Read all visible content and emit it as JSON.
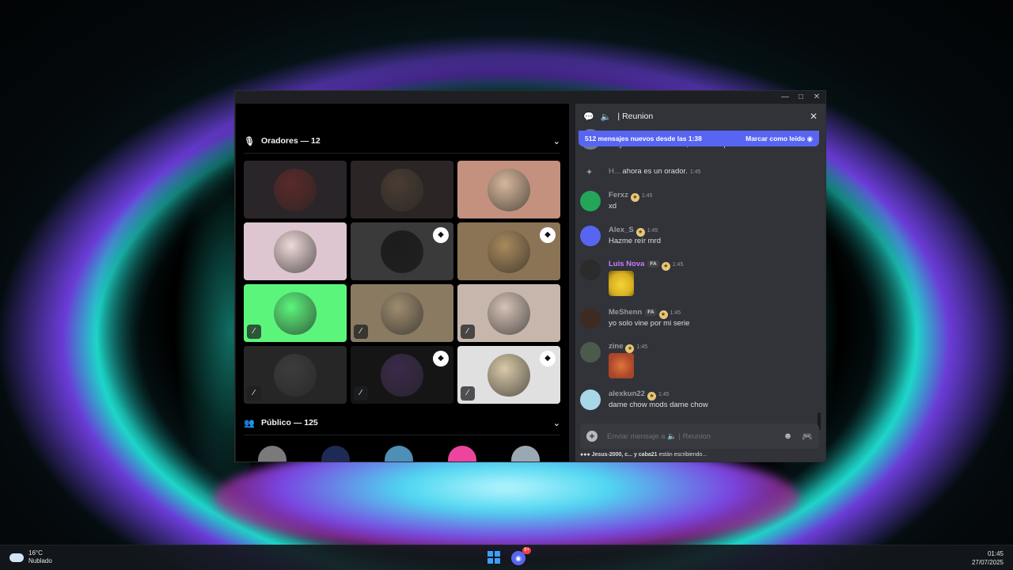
{
  "stage": {
    "speakers_header": "Oradores — 12",
    "audience_header": "Público — 125",
    "speakers": [
      {
        "bg": "#2a2528",
        "avatar_color": "#5a2a2a",
        "badge": false,
        "muted": false
      },
      {
        "bg": "#2b2625",
        "avatar_color": "#4a3c33",
        "badge": false,
        "muted": false
      },
      {
        "bg": "#c4917f",
        "avatar_color": "#d7b79b",
        "badge": false,
        "muted": false
      },
      {
        "bg": "#ddc6cf",
        "avatar_color": "#efd8d8",
        "badge": false,
        "muted": false
      },
      {
        "bg": "#3a3a3a",
        "avatar_color": "#1c1c1c",
        "badge": true,
        "muted": false
      },
      {
        "bg": "#8b7455",
        "avatar_color": "#a88a5c",
        "badge": true,
        "muted": false
      },
      {
        "bg": "#5cf57c",
        "avatar_color": "#5cf57c",
        "badge": false,
        "muted": true
      },
      {
        "bg": "#8a7a62",
        "avatar_color": "#9e8c70",
        "badge": false,
        "muted": true
      },
      {
        "bg": "#c7b6ac",
        "avatar_color": "#d5c2b6",
        "badge": false,
        "muted": true
      },
      {
        "bg": "#262626",
        "avatar_color": "#3d3d3d",
        "badge": false,
        "muted": true
      },
      {
        "bg": "#151515",
        "avatar_color": "#3a2a4a",
        "badge": true,
        "muted": true
      },
      {
        "bg": "#e0e0e0",
        "avatar_color": "#d9c9a8",
        "badge": true,
        "muted": true
      }
    ],
    "audience": [
      {
        "color": "#7a7a7a"
      },
      {
        "color": "#1e2a55"
      },
      {
        "color": "#4d8fb5"
      },
      {
        "color": "#eb459e"
      },
      {
        "color": "#9aa8b3"
      }
    ]
  },
  "chat": {
    "channel_name": "Reunion",
    "banner_text": "512 mensajes nuevos desde las 1:38",
    "banner_action": "Marcar como leído",
    "messages": [
      {
        "name": "",
        "time": "",
        "text": "Yo ya hablé demasiado, hasta me puse sentimental",
        "avatar_color": "#6d7d92",
        "name_color": "#949ba4"
      },
      {
        "name": "H...",
        "time": "1:45",
        "text": "ahora es un orador.",
        "system": true
      },
      {
        "name": "Ferxz",
        "time": "1:45",
        "text": "xd",
        "avatar_color": "#23a55a",
        "name_color": "#949ba4"
      },
      {
        "name": "Alex_S",
        "time": "1:45",
        "text": "Hazme reír mrd",
        "avatar_color": "#5865f2",
        "name_color": "#949ba4"
      },
      {
        "name": "Luis Nova",
        "time": "1:45",
        "tag": "FA",
        "text": "",
        "avatar_color": "#2b2b2b",
        "name_color": "#c77dff"
      },
      {
        "name": "MeShenn",
        "time": "1:45",
        "tag": "FA",
        "text": "yo solo vine por mi serie",
        "avatar_color": "#3d2b22",
        "name_color": "#949ba4"
      },
      {
        "name": "zine",
        "time": "1:45",
        "text": "",
        "avatar_color": "#4b5a4b",
        "name_color": "#949ba4"
      },
      {
        "name": "alexkun22",
        "time": "1:45",
        "text": "dame chow mods dame chow",
        "avatar_color": "#a8d8e8",
        "name_color": "#949ba4"
      }
    ],
    "composer_placeholder": "Enviar mensaje a",
    "composer_channel": "| Reunion",
    "typing_names": "Jesus-2000, c... y caba21",
    "typing_suffix": "están escribiendo..."
  },
  "taskbar": {
    "temperature": "16°C",
    "weather": "Nublado",
    "discord_badge": "9+",
    "time": "01:45",
    "date": "27/07/2025"
  }
}
